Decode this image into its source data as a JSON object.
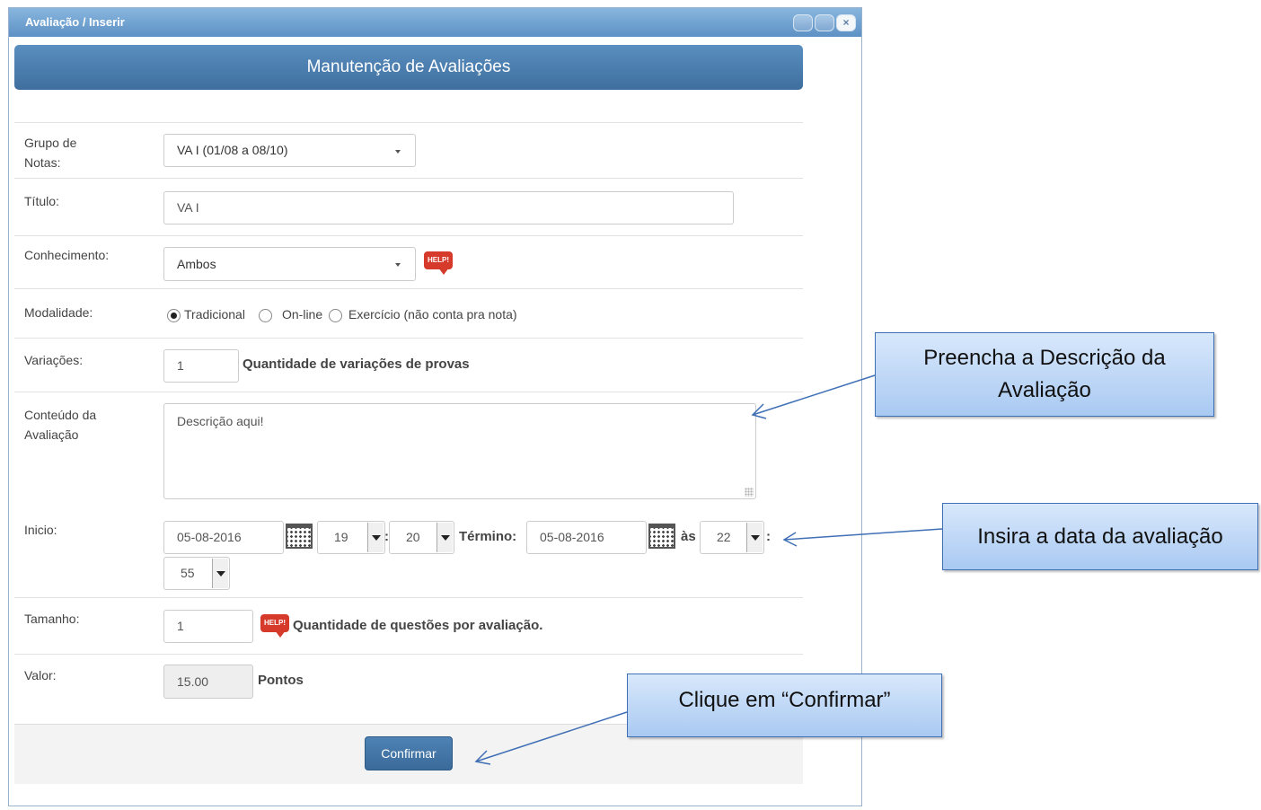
{
  "window": {
    "title": "Avaliação / Inserir",
    "close_glyph": "×"
  },
  "header": {
    "title": "Manutenção de Avaliações"
  },
  "form": {
    "grupo": {
      "label_line1": "Grupo de",
      "label_line2": "Notas:",
      "value": "VA I (01/08 a 08/10)"
    },
    "titulo": {
      "label": "Título:",
      "value": "VA I"
    },
    "conhecimento": {
      "label": "Conhecimento:",
      "value": "Ambos",
      "help": "HELP!"
    },
    "modalidade": {
      "label": "Modalidade:",
      "options": [
        "Tradicional",
        "On-line",
        "Exercício (não conta pra nota)"
      ],
      "selected": "Tradicional"
    },
    "variacoes": {
      "label": "Variações:",
      "value": "1",
      "hint": "Quantidade de variações de provas"
    },
    "conteudo": {
      "label_line1": "Conteúdo da",
      "label_line2": "Avaliação",
      "value": "Descrição aqui!"
    },
    "inicio": {
      "label": "Inicio:",
      "date": "05-08-2016",
      "hour": "19",
      "sep": ":",
      "minute": "20"
    },
    "termino": {
      "label": "Término:",
      "date": "05-08-2016",
      "as_label": "às",
      "hour": "22",
      "sep": ":",
      "minute": "55"
    },
    "tamanho": {
      "label": "Tamanho:",
      "value": "1",
      "help": "HELP!",
      "hint": "Quantidade de questões por avaliação."
    },
    "valor": {
      "label": "Valor:",
      "value": "15.00",
      "unit": "Pontos"
    }
  },
  "footer": {
    "confirm_label": "Confirmar"
  },
  "callouts": {
    "descricao": {
      "line1": "Preencha a Descrição da",
      "line2": "Avaliação"
    },
    "data": "Insira a data da avaliação",
    "confirmar": "Clique em “Confirmar”"
  }
}
